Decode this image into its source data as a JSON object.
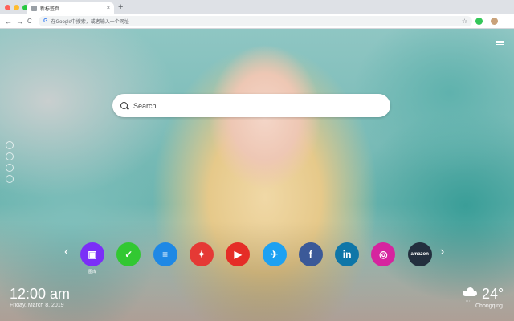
{
  "browser": {
    "tab_title": "新标签页",
    "tab_close": "×",
    "new_tab": "+",
    "omnibox_text": "在Google中搜索，或者输入一个网址",
    "nav": {
      "back": "←",
      "forward": "→",
      "reload": "C"
    },
    "star": "☆",
    "menu": "⋮",
    "traffic_colors": [
      "#ff5f57",
      "#febc2e",
      "#28c840"
    ]
  },
  "search": {
    "placeholder": "Search"
  },
  "shortcuts": [
    {
      "name": "photo-editor",
      "icon": "image-icon",
      "color": "#7b2ff7",
      "label": "图库"
    },
    {
      "name": "checkmark-app",
      "icon": "check-icon",
      "color": "#32c832",
      "label": ""
    },
    {
      "name": "notes-app",
      "icon": "note-icon",
      "color": "#1e88e5",
      "label": ""
    },
    {
      "name": "game-app",
      "icon": "gamepad-icon",
      "color": "#e53935",
      "label": ""
    },
    {
      "name": "youtube",
      "icon": "youtube-icon",
      "color": "#e52d27",
      "label": ""
    },
    {
      "name": "twitter",
      "icon": "twitter-icon",
      "color": "#1da1f2",
      "label": ""
    },
    {
      "name": "facebook",
      "icon": "facebook-icon",
      "color": "#3b5998",
      "label": ""
    },
    {
      "name": "linkedin",
      "icon": "linkedin-icon",
      "color": "#0e76a8",
      "label": ""
    },
    {
      "name": "instagram",
      "icon": "instagram-icon",
      "color": "#d6249f",
      "label": ""
    },
    {
      "name": "amazon",
      "icon": "amazon-icon",
      "color": "#232f3e",
      "label": "amazon"
    }
  ],
  "clock": {
    "time": "12:00 am",
    "date": "Friday, March 8, 2019"
  },
  "weather": {
    "temp": "24°",
    "city": "Chongqing",
    "icon": "cloud-rain-icon"
  }
}
